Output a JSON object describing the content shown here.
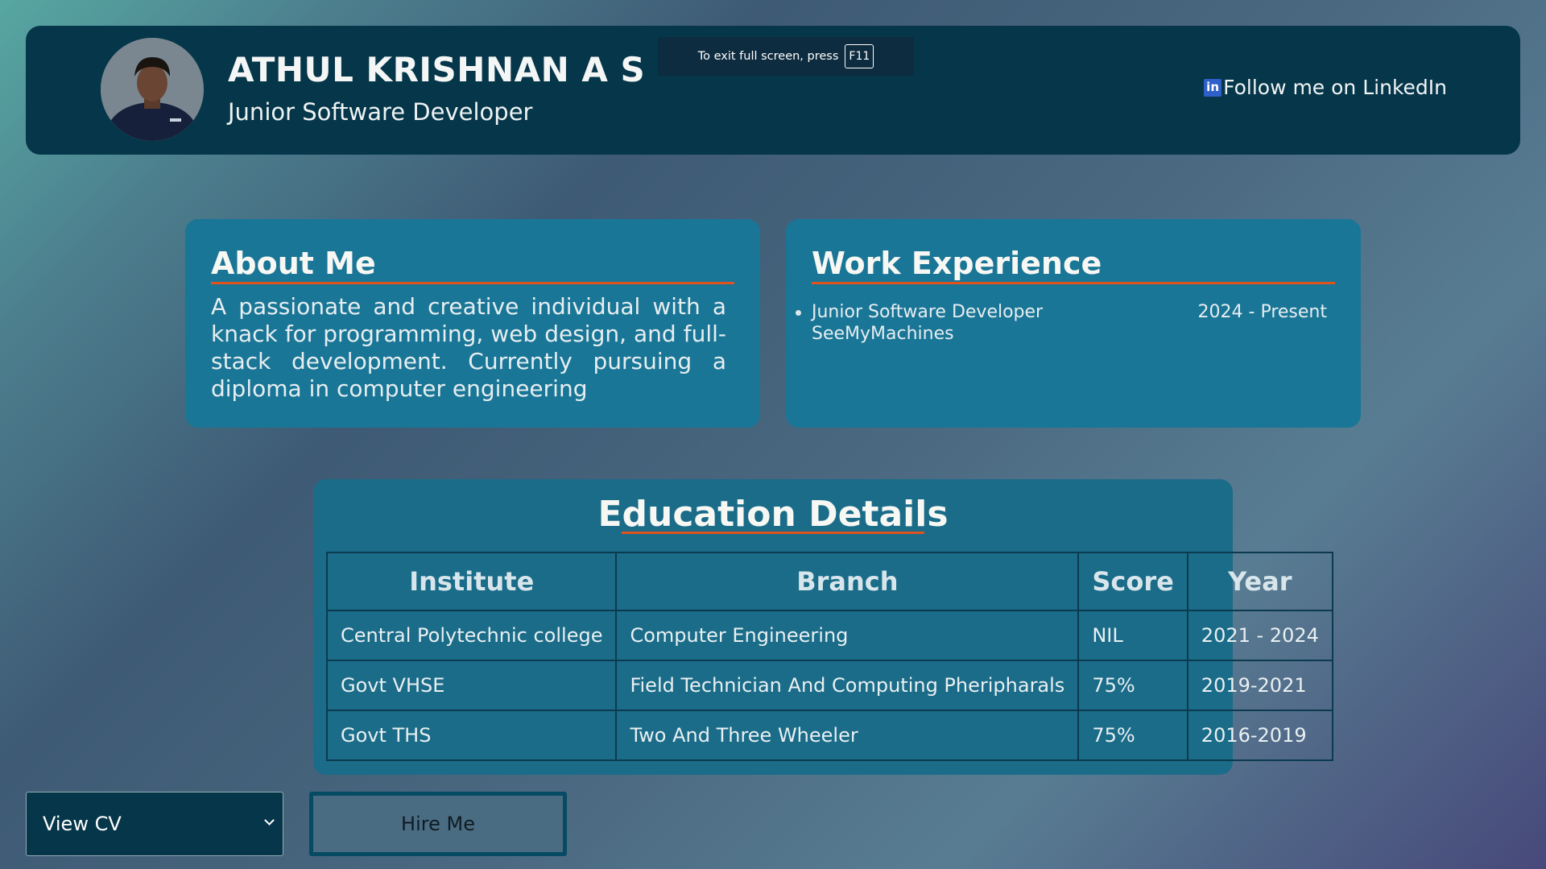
{
  "header": {
    "name": "ATHUL KRISHNAN A S",
    "role": "Junior Software Developer",
    "linkedin_icon": "in",
    "linkedin_label": "Follow me on LinkedIn"
  },
  "fullscreen_toast": {
    "text": "To exit full screen, press",
    "key": "F11"
  },
  "about": {
    "title": "About Me",
    "text": "A passionate and creative individual with a knack for programming, web design, and full-stack development. Currently pursuing a diploma in computer engineering"
  },
  "work": {
    "title": "Work Experience",
    "items": [
      {
        "role": "Junior Software Developer",
        "company": "SeeMyMachines",
        "period": "2024 - Present"
      }
    ]
  },
  "education": {
    "title": "Education Details",
    "columns": [
      "Institute",
      "Branch",
      "Score",
      "Year"
    ],
    "rows": [
      [
        "Central Polytechnic college",
        "Computer Engineering",
        "NIL",
        "2021 - 2024"
      ],
      [
        "Govt VHSE",
        "Field Technician And Computing Pheripharals",
        "75%",
        "2019-2021"
      ],
      [
        "Govt THS",
        "Two And Three Wheeler",
        "75%",
        "2016-2019"
      ]
    ]
  },
  "controls": {
    "cv_select_value": "View CV",
    "hire_label": "Hire Me"
  },
  "colors": {
    "header_bg": "#05364a",
    "card_bg": "#1a7696",
    "accent_underline": "#e0531e"
  }
}
